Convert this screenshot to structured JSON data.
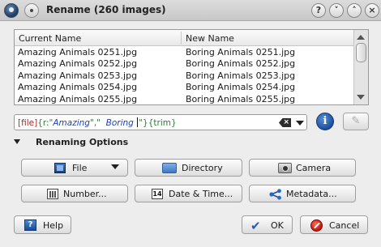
{
  "window": {
    "title": "Rename (260 images)",
    "controls": {
      "help": "?",
      "minimize": "˅",
      "maximize": "˄",
      "close": "×"
    }
  },
  "list": {
    "columns": [
      "Current Name",
      "New Name"
    ],
    "rows": [
      [
        "Amazing Animals 0251.jpg",
        "Boring Animals 0251.jpg"
      ],
      [
        "Amazing Animals 0252.jpg",
        "Boring Animals 0252.jpg"
      ],
      [
        "Amazing Animals 0253.jpg",
        "Boring Animals 0253.jpg"
      ],
      [
        "Amazing Animals 0254.jpg",
        "Boring Animals 0254.jpg"
      ],
      [
        "Amazing Animals 0255.jpg",
        "Boring Animals 0255.jpg"
      ]
    ]
  },
  "pattern": {
    "t1": "[file]",
    "t2": "{r:\"",
    "t3": "Amazing",
    "t4": "\",\"",
    "t5": "  Boring ",
    "t6": "\"}",
    "t7": "{trim}"
  },
  "options": {
    "section_label": "Renaming Options",
    "file": "File",
    "directory": "Directory",
    "camera": "Camera",
    "number": "Number...",
    "date_time": "Date & Time...",
    "metadata": "Metadata...",
    "date_icon_text": "14"
  },
  "buttons": {
    "help": "Help",
    "ok": "OK",
    "cancel": "Cancel",
    "help_icon_text": "?",
    "info_icon_text": "i",
    "ok_icon_text": "✔",
    "edit_icon_text": "✎",
    "clear_icon_text": "×"
  }
}
